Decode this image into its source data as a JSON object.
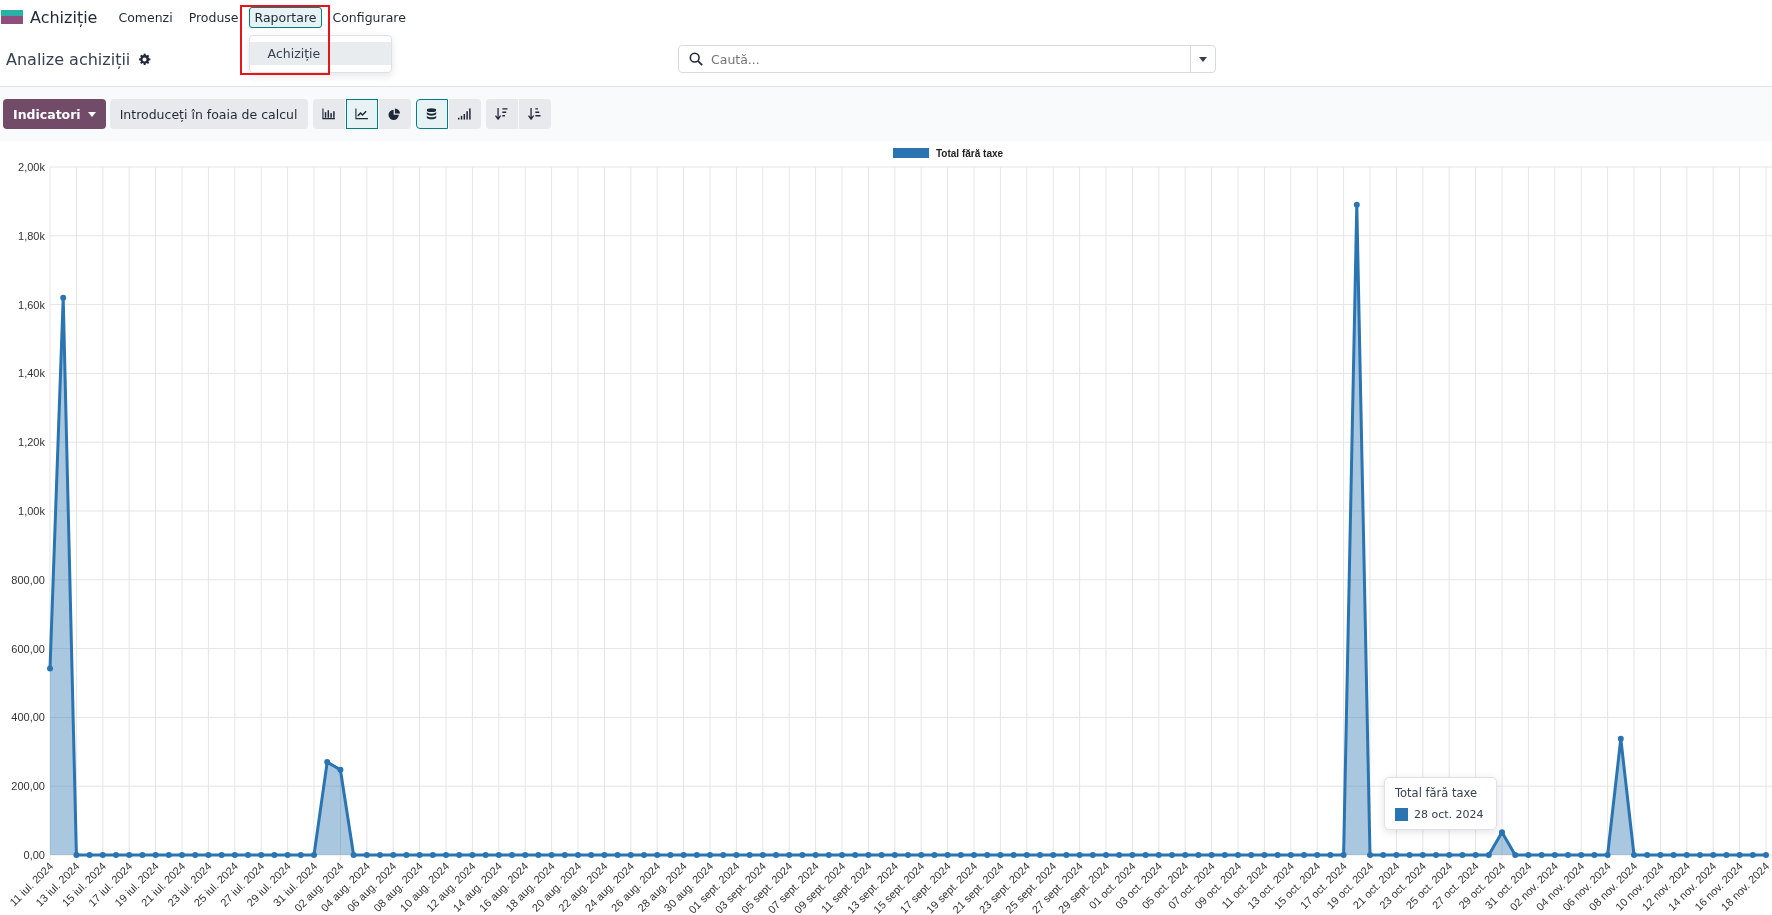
{
  "navbar": {
    "app_name": "Achiziție",
    "menu": [
      {
        "label": "Comenzi",
        "selected": false,
        "expanded": false
      },
      {
        "label": "Produse",
        "selected": false,
        "expanded": false
      },
      {
        "label": "Raportare",
        "selected": true,
        "expanded": true
      },
      {
        "label": "Configurare",
        "selected": false,
        "expanded": false
      }
    ],
    "dropdown": {
      "items": [
        {
          "label": "Achiziție",
          "selected": true
        }
      ]
    }
  },
  "page_title": "Analize achiziții",
  "search": {
    "placeholder": "Caută..."
  },
  "toolbar": {
    "primary": {
      "label": "Indicatori"
    },
    "secondary": {
      "label": "Introduceți în foaia de calcul"
    },
    "groups": [
      [
        {
          "kind": "bar",
          "selected": false
        },
        {
          "kind": "line",
          "selected": true
        },
        {
          "kind": "pie",
          "selected": false
        }
      ],
      [
        {
          "kind": "stacked",
          "selected": true
        },
        {
          "kind": "cumulative",
          "selected": false
        }
      ],
      [
        {
          "kind": "sort_desc",
          "selected": false
        },
        {
          "kind": "sort_asc",
          "selected": false
        }
      ]
    ]
  },
  "chart": {
    "chart_data": {
      "type": "area",
      "grid": true,
      "ylim": [
        0,
        2000
      ],
      "categories": [
        "11 iul. 2024",
        null,
        "13 iul. 2024",
        null,
        "15 iul. 2024",
        null,
        "17 iul. 2024",
        null,
        "19 iul. 2024",
        null,
        "21 iul. 2024",
        null,
        "23 iul. 2024",
        null,
        "25 iul. 2024",
        null,
        "27 iul. 2024",
        null,
        "29 iul. 2024",
        null,
        "31 iul. 2024",
        null,
        "02 aug. 2024",
        null,
        "04 aug. 2024",
        null,
        "06 aug. 2024",
        null,
        "08 aug. 2024",
        null,
        "10 aug. 2024",
        null,
        "12 aug. 2024",
        null,
        "14 aug. 2024",
        null,
        "16 aug. 2024",
        null,
        "18 aug. 2024",
        null,
        "20 aug. 2024",
        null,
        "22 aug. 2024",
        null,
        "24 aug. 2024",
        null,
        "26 aug. 2024",
        null,
        "28 aug. 2024",
        null,
        "30 aug. 2024",
        null,
        "01 sept. 2024",
        null,
        "03 sept. 2024",
        null,
        "05 sept. 2024",
        null,
        "07 sept. 2024",
        null,
        "09 sept. 2024",
        null,
        "11 sept. 2024",
        null,
        "13 sept. 2024",
        null,
        "15 sept. 2024",
        null,
        "17 sept. 2024",
        null,
        "19 sept. 2024",
        null,
        "21 sept. 2024",
        null,
        "23 sept. 2024",
        null,
        "25 sept. 2024",
        null,
        "27 sept. 2024",
        null,
        "29 sept. 2024",
        null,
        "01 oct. 2024",
        null,
        "03 oct. 2024",
        null,
        "05 oct. 2024",
        null,
        "07 oct. 2024",
        null,
        "09 oct. 2024",
        null,
        "11 oct. 2024",
        null,
        "13 oct. 2024",
        null,
        "15 oct. 2024",
        null,
        "17 oct. 2024",
        null,
        "19 oct. 2024",
        null,
        "21 oct. 2024",
        null,
        "23 oct. 2024",
        null,
        "25 oct. 2024",
        null,
        "27 oct. 2024",
        null,
        "29 oct. 2024",
        null,
        "31 oct. 2024",
        null,
        "02 nov. 2024",
        null,
        "04 nov. 2024",
        null,
        "06 nov. 2024",
        null,
        "08 nov. 2024",
        null,
        "10 nov. 2024",
        null,
        "12 nov. 2024",
        null,
        "14 nov. 2024",
        null,
        "16 nov. 2024",
        null,
        "18 nov. 2024"
      ],
      "series": [
        {
          "name": "Total fără taxe",
          "color": "#2a74b2",
          "values": [
            542,
            1620,
            0,
            0,
            0,
            0,
            0,
            0,
            0,
            0,
            0,
            0,
            0,
            0,
            0,
            0,
            0,
            0,
            0,
            0,
            0,
            270,
            248,
            0,
            0,
            0,
            0,
            0,
            0,
            0,
            0,
            0,
            0,
            0,
            0,
            0,
            0,
            0,
            0,
            0,
            0,
            0,
            0,
            0,
            0,
            0,
            0,
            0,
            0,
            0,
            0,
            0,
            0,
            0,
            0,
            0,
            0,
            0,
            0,
            0,
            0,
            0,
            0,
            0,
            0,
            0,
            0,
            0,
            0,
            0,
            0,
            0,
            0,
            0,
            0,
            0,
            0,
            0,
            0,
            0,
            0,
            0,
            0,
            0,
            0,
            0,
            0,
            0,
            0,
            0,
            0,
            0,
            0,
            0,
            0,
            0,
            0,
            0,
            0,
            1890,
            0,
            0,
            0,
            0,
            0,
            0,
            0,
            0,
            0,
            0,
            66,
            0,
            0,
            0,
            0,
            0,
            0,
            0,
            0,
            338,
            0,
            0,
            0,
            0,
            0,
            0,
            0,
            0,
            0,
            0,
            0
          ]
        }
      ],
      "yticks": [
        {
          "value": 0,
          "label": "0,00"
        },
        {
          "value": 200,
          "label": "200,00"
        },
        {
          "value": 400,
          "label": "400,00"
        },
        {
          "value": 600,
          "label": "600,00"
        },
        {
          "value": 800,
          "label": "800,00"
        },
        {
          "value": 1000,
          "label": "1,00k"
        },
        {
          "value": 1200,
          "label": "1,20k"
        },
        {
          "value": 1400,
          "label": "1,40k"
        },
        {
          "value": 1600,
          "label": "1,60k"
        },
        {
          "value": 1800,
          "label": "1,80k"
        },
        {
          "value": 2000,
          "label": "2,00k"
        }
      ]
    },
    "tooltip": {
      "title": "Total fără taxe",
      "label": "28 oct. 2024"
    }
  }
}
